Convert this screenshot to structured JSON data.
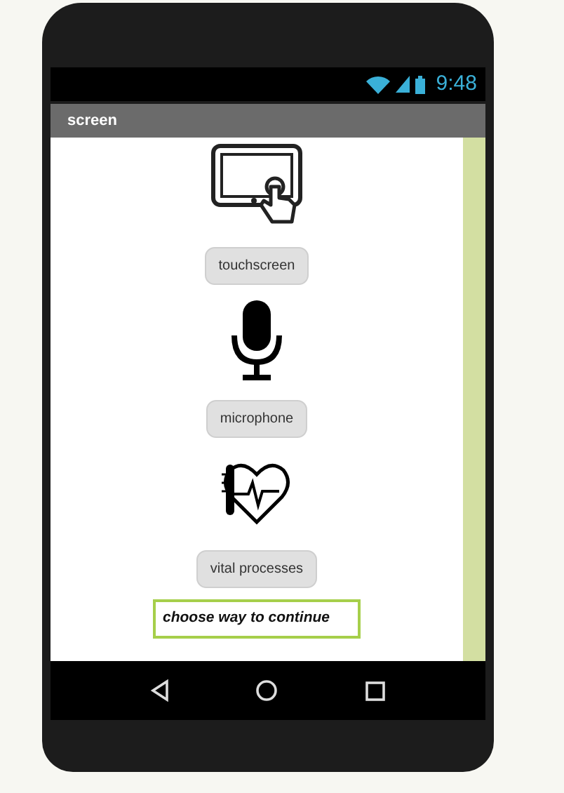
{
  "status_bar": {
    "time": "9:48"
  },
  "title_bar": {
    "title": "screen"
  },
  "items": [
    {
      "button": "touchscreen"
    },
    {
      "button": "microphone"
    },
    {
      "button": "vital processes"
    }
  ],
  "text_box": {
    "value": "choose way to continue"
  }
}
